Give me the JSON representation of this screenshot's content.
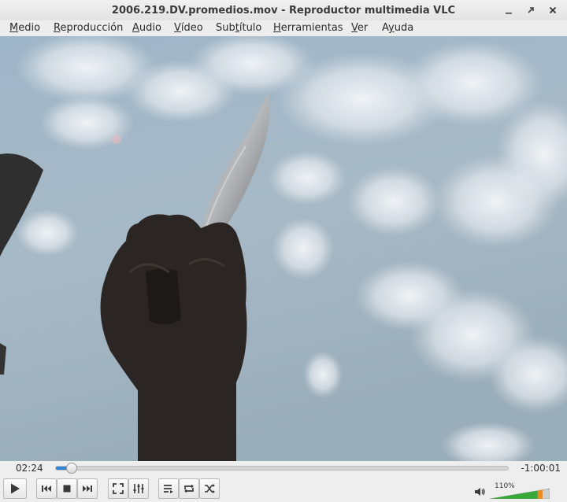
{
  "window": {
    "title": "2006.219.DV.promedios.mov - Reproductor multimedia VLC",
    "controls": {
      "minimize_icon": "minimize-icon",
      "maximize_icon": "maximize-icon",
      "close_icon": "close-icon"
    }
  },
  "menu": {
    "items": [
      {
        "label": "Medio",
        "mnemonic": "M"
      },
      {
        "label": "Reproducción",
        "mnemonic": "R"
      },
      {
        "label": "Audio",
        "mnemonic": "A"
      },
      {
        "label": "Vídeo",
        "mnemonic": "V"
      },
      {
        "label": "Subtítulo",
        "mnemonic": "t"
      },
      {
        "label": "Herramientas",
        "mnemonic": "H"
      },
      {
        "label": "Ver",
        "mnemonic": "V"
      },
      {
        "label": "Ayuda",
        "mnemonic": "y"
      }
    ]
  },
  "playback": {
    "elapsed": "02:24",
    "remaining": "-1:00:01",
    "progress": 0.034
  },
  "controls": {
    "play_icon": "play-icon",
    "previous_icon": "previous-icon",
    "stop_icon": "stop-icon",
    "next_icon": "next-icon",
    "fullscreen_icon": "fullscreen-icon",
    "extended_settings_icon": "equalizer-icon",
    "playlist_icon": "playlist-icon",
    "loop_icon": "loop-icon",
    "random_icon": "shuffle-icon"
  },
  "volume": {
    "percent_label": "110%",
    "level": 1.1,
    "icon": "speaker-icon"
  },
  "colors": {
    "accent": "#2f82d6",
    "volume_green": "#39a83a",
    "volume_orange": "#f08a1a"
  }
}
